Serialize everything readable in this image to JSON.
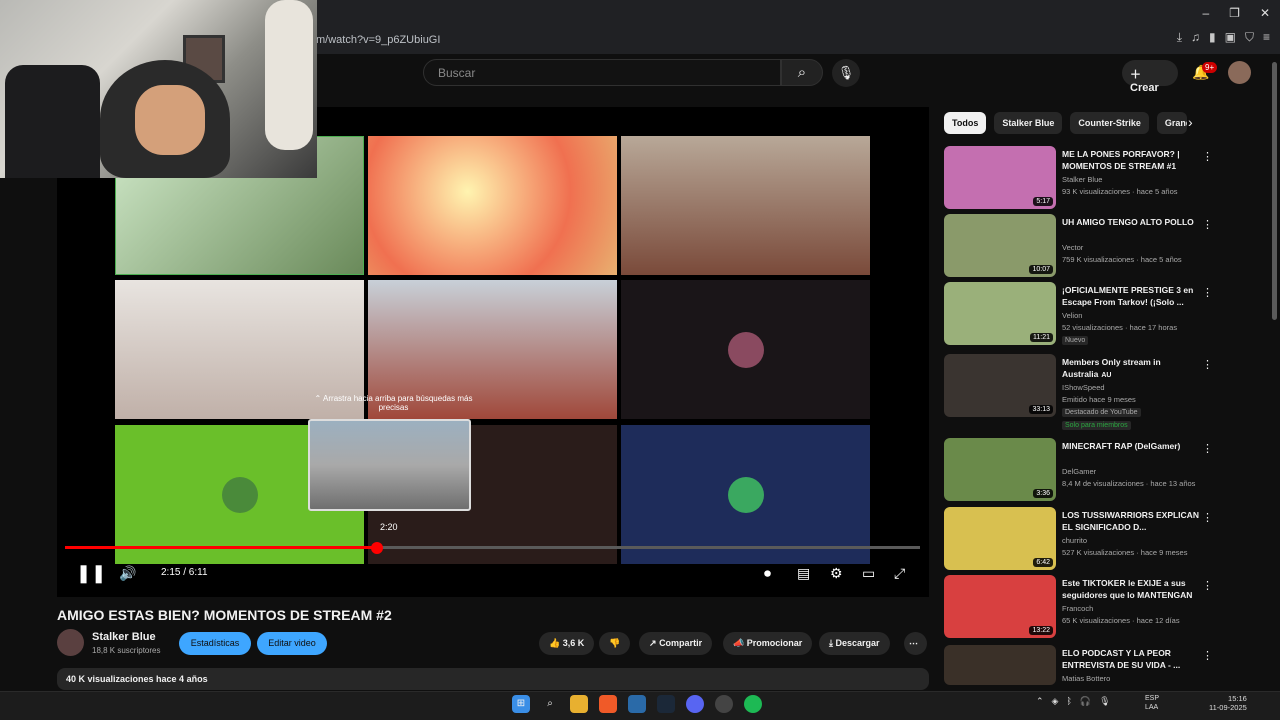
{
  "browser": {
    "url": "m/watch?v=9_p6ZUbiuGI"
  },
  "header": {
    "search_placeholder": "Buscar",
    "create_label": "Crear",
    "notif_badge": "9+"
  },
  "player": {
    "tooltip": "⌃ Arrastra hacia arriba para búsquedas más precisas",
    "preview_time": "2:20",
    "current_time": "2:15 / 6:11",
    "progress": 0.365,
    "hover_position": 0.388
  },
  "video": {
    "title": "AMIGO ESTAS BIEN? MOMENTOS DE STREAM #2",
    "channel": "Stalker Blue",
    "subscribers": "18,8 K suscriptores",
    "stats_label": "Estadísticas",
    "edit_label": "Editar video",
    "likes": "3,6 K",
    "share_label": "Compartir",
    "promote_label": "Promocionar",
    "download_label": "Descargar",
    "description_meta": "40 K visualizaciones  hace 4 años"
  },
  "chips": [
    "Todos",
    "Stalker Blue",
    "Counter-Strike",
    "Grand"
  ],
  "recommendations": [
    {
      "title": "ME LA PONES PORFAVOR? | MOMENTOS DE STREAM #1",
      "channel": "Stalker Blue",
      "meta": "93 K visualizaciones · hace 5 años",
      "duration": "5:17",
      "color": "#c46fb0"
    },
    {
      "title": "UH AMIGO TENGO ALTO POLLO",
      "channel": "Vector",
      "meta": "759 K visualizaciones · hace 5 años",
      "duration": "10:07",
      "color": "#8a9a6a"
    },
    {
      "title": "¡OFICIALMENTE PRESTIGE 3 en Escape From Tarkov! (¡Solo ...",
      "channel": "Velion",
      "meta": "52 visualizaciones · hace 17 horas",
      "duration": "11:21",
      "color": "#9ab07a",
      "tag": "Nuevo"
    },
    {
      "title": "Members Only stream in Australia",
      "channel": "IShowSpeed",
      "meta": "Emitido hace 9 meses",
      "duration": "33:13",
      "color": "#3a3430",
      "tag": "Destacado de YouTube",
      "tag2": "Solo para miembros",
      "suffix": "AU"
    },
    {
      "title": "MINECRAFT RAP (DelGamer)",
      "channel": "DelGamer",
      "meta": "8,4 M de visualizaciones · hace 13 años",
      "duration": "3:36",
      "color": "#6a8a4a"
    },
    {
      "title": "LOS TUSSIWARRIORS EXPLICAN EL SIGNIFICADO D...",
      "channel": "churrito",
      "meta": "527 K visualizaciones · hace 9 meses",
      "duration": "6:42",
      "color": "#d8c050"
    },
    {
      "title": "Este TIKTOKER  le EXIJE a sus seguidores que lo MANTENGAN",
      "channel": "Francoch",
      "meta": "65 K visualizaciones · hace 12 días",
      "duration": "13:22",
      "color": "#d84040"
    },
    {
      "title": "ELO PODCAST Y LA PEOR ENTREVISTA DE SU VIDA - ...",
      "channel": "Matias Bottero",
      "meta": "",
      "duration": "",
      "color": "#3a3028"
    }
  ],
  "taskbar": {
    "lang1": "ESP",
    "lang2": "LAA",
    "time": "15:16",
    "date": "11-09-2025"
  }
}
